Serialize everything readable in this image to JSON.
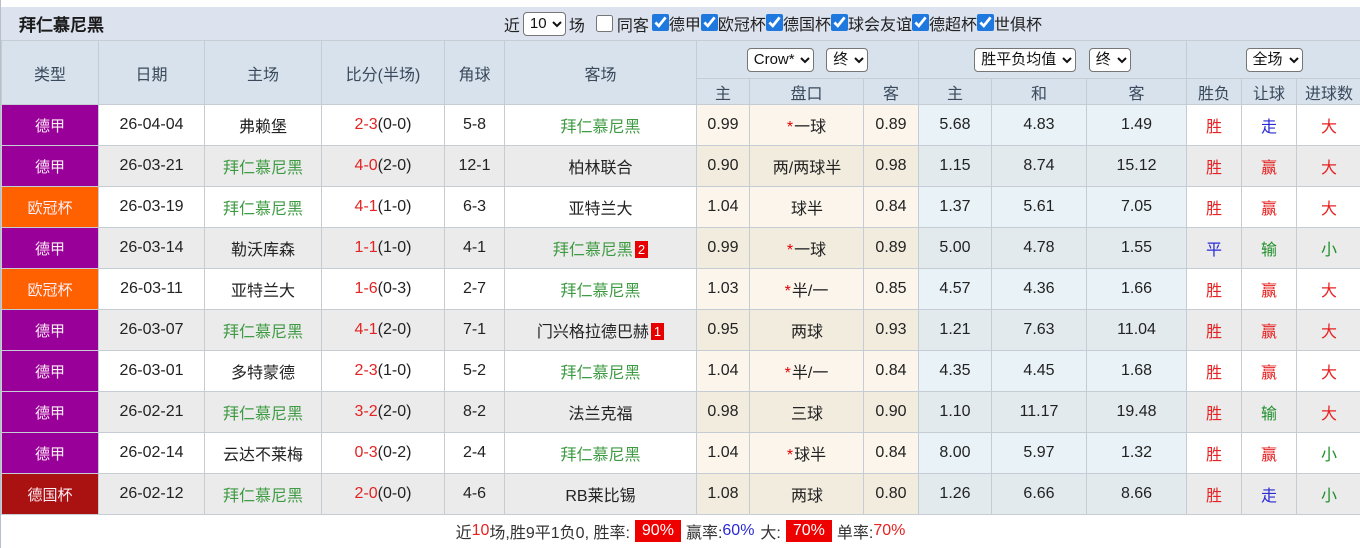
{
  "title": "拜仁慕尼黑",
  "colors": {
    "badge_red": "#e60000",
    "bayern_green": "#3f9b43",
    "rate_highlight": "#ee0000",
    "checkbox_blue": "#1e78dd",
    "league_bundesliga": "#990099",
    "league_ucl": "#ff6000",
    "league_dfb_pokal": "#aa1111"
  },
  "filters": {
    "recent_label": "近",
    "recent_value": "10",
    "matches_label": "场",
    "same_venue": {
      "label": "同客",
      "checked": false
    },
    "leagues": [
      {
        "label": "德甲",
        "checked": true
      },
      {
        "label": "欧冠杯",
        "checked": true
      },
      {
        "label": "德国杯",
        "checked": true
      },
      {
        "label": "球会友谊",
        "checked": true
      },
      {
        "label": "德超杯",
        "checked": true
      },
      {
        "label": "世俱杯",
        "checked": true
      }
    ]
  },
  "table": {
    "headers": {
      "main": [
        "类型",
        "日期",
        "主场",
        "比分(半场)",
        "角球",
        "客场"
      ],
      "sub": [
        "主",
        "盘口",
        "客",
        "主",
        "和",
        "客",
        "胜负",
        "让球",
        "进球数"
      ]
    },
    "selects": {
      "crow_company": "Crow*",
      "crow_time": "终",
      "avg_company": "胜平负均值",
      "avg_time": "终",
      "scope": "全场"
    },
    "rows": [
      {
        "league": "德甲",
        "league_color": "#990099",
        "date": "26-04-04",
        "home": {
          "name": "弗赖堡",
          "is_bayern": false,
          "badge": null
        },
        "score": {
          "main": "2-3",
          "half": "(0-0)"
        },
        "corners": "5-8",
        "away": {
          "name": "拜仁慕尼黑",
          "is_bayern": true,
          "badge": null
        },
        "crow": {
          "home": "0.99",
          "starred": true,
          "handicap": "一球",
          "away": "0.89"
        },
        "odds": {
          "home": "5.68",
          "draw": "4.83",
          "away": "1.49"
        },
        "results": [
          {
            "text": "胜",
            "color": "red"
          },
          {
            "text": "走",
            "color": "blue"
          },
          {
            "text": "大",
            "color": "red"
          }
        ]
      },
      {
        "league": "德甲",
        "league_color": "#990099",
        "date": "26-03-21",
        "home": {
          "name": "拜仁慕尼黑",
          "is_bayern": true,
          "badge": null
        },
        "score": {
          "main": "4-0",
          "half": "(2-0)"
        },
        "corners": "12-1",
        "away": {
          "name": "柏林联合",
          "is_bayern": false,
          "badge": null
        },
        "crow": {
          "home": "0.90",
          "starred": false,
          "handicap": "两/两球半",
          "away": "0.98"
        },
        "odds": {
          "home": "1.15",
          "draw": "8.74",
          "away": "15.12"
        },
        "results": [
          {
            "text": "胜",
            "color": "red"
          },
          {
            "text": "赢",
            "color": "red"
          },
          {
            "text": "大",
            "color": "red"
          }
        ]
      },
      {
        "league": "欧冠杯",
        "league_color": "#ff6000",
        "date": "26-03-19",
        "home": {
          "name": "拜仁慕尼黑",
          "is_bayern": true,
          "badge": null
        },
        "score": {
          "main": "4-1",
          "half": "(1-0)"
        },
        "corners": "6-3",
        "away": {
          "name": "亚特兰大",
          "is_bayern": false,
          "badge": null
        },
        "crow": {
          "home": "1.04",
          "starred": false,
          "handicap": "球半",
          "away": "0.84"
        },
        "odds": {
          "home": "1.37",
          "draw": "5.61",
          "away": "7.05"
        },
        "results": [
          {
            "text": "胜",
            "color": "red"
          },
          {
            "text": "赢",
            "color": "red"
          },
          {
            "text": "大",
            "color": "red"
          }
        ]
      },
      {
        "league": "德甲",
        "league_color": "#990099",
        "date": "26-03-14",
        "home": {
          "name": "勒沃库森",
          "is_bayern": false,
          "badge": null
        },
        "score": {
          "main": "1-1",
          "half": "(1-0)"
        },
        "corners": "4-1",
        "away": {
          "name": "拜仁慕尼黑",
          "is_bayern": true,
          "badge": "2"
        },
        "crow": {
          "home": "0.99",
          "starred": true,
          "handicap": "一球",
          "away": "0.89"
        },
        "odds": {
          "home": "5.00",
          "draw": "4.78",
          "away": "1.55"
        },
        "results": [
          {
            "text": "平",
            "color": "blue"
          },
          {
            "text": "输",
            "color": "green"
          },
          {
            "text": "小",
            "color": "green"
          }
        ]
      },
      {
        "league": "欧冠杯",
        "league_color": "#ff6000",
        "date": "26-03-11",
        "home": {
          "name": "亚特兰大",
          "is_bayern": false,
          "badge": null
        },
        "score": {
          "main": "1-6",
          "half": "(0-3)"
        },
        "corners": "2-7",
        "away": {
          "name": "拜仁慕尼黑",
          "is_bayern": true,
          "badge": null
        },
        "crow": {
          "home": "1.03",
          "starred": true,
          "handicap": "半/一",
          "away": "0.85"
        },
        "odds": {
          "home": "4.57",
          "draw": "4.36",
          "away": "1.66"
        },
        "results": [
          {
            "text": "胜",
            "color": "red"
          },
          {
            "text": "赢",
            "color": "red"
          },
          {
            "text": "大",
            "color": "red"
          }
        ]
      },
      {
        "league": "德甲",
        "league_color": "#990099",
        "date": "26-03-07",
        "home": {
          "name": "拜仁慕尼黑",
          "is_bayern": true,
          "badge": null
        },
        "score": {
          "main": "4-1",
          "half": "(2-0)"
        },
        "corners": "7-1",
        "away": {
          "name": "门兴格拉德巴赫",
          "is_bayern": false,
          "badge": "1"
        },
        "crow": {
          "home": "0.95",
          "starred": false,
          "handicap": "两球",
          "away": "0.93"
        },
        "odds": {
          "home": "1.21",
          "draw": "7.63",
          "away": "11.04"
        },
        "results": [
          {
            "text": "胜",
            "color": "red"
          },
          {
            "text": "赢",
            "color": "red"
          },
          {
            "text": "大",
            "color": "red"
          }
        ]
      },
      {
        "league": "德甲",
        "league_color": "#990099",
        "date": "26-03-01",
        "home": {
          "name": "多特蒙德",
          "is_bayern": false,
          "badge": null
        },
        "score": {
          "main": "2-3",
          "half": "(1-0)"
        },
        "corners": "5-2",
        "away": {
          "name": "拜仁慕尼黑",
          "is_bayern": true,
          "badge": null
        },
        "crow": {
          "home": "1.04",
          "starred": true,
          "handicap": "半/一",
          "away": "0.84"
        },
        "odds": {
          "home": "4.35",
          "draw": "4.45",
          "away": "1.68"
        },
        "results": [
          {
            "text": "胜",
            "color": "red"
          },
          {
            "text": "赢",
            "color": "red"
          },
          {
            "text": "大",
            "color": "red"
          }
        ]
      },
      {
        "league": "德甲",
        "league_color": "#990099",
        "date": "26-02-21",
        "home": {
          "name": "拜仁慕尼黑",
          "is_bayern": true,
          "badge": null
        },
        "score": {
          "main": "3-2",
          "half": "(2-0)"
        },
        "corners": "8-2",
        "away": {
          "name": "法兰克福",
          "is_bayern": false,
          "badge": null
        },
        "crow": {
          "home": "0.98",
          "starred": false,
          "handicap": "三球",
          "away": "0.90"
        },
        "odds": {
          "home": "1.10",
          "draw": "11.17",
          "away": "19.48"
        },
        "results": [
          {
            "text": "胜",
            "color": "red"
          },
          {
            "text": "输",
            "color": "green"
          },
          {
            "text": "大",
            "color": "red"
          }
        ]
      },
      {
        "league": "德甲",
        "league_color": "#990099",
        "date": "26-02-14",
        "home": {
          "name": "云达不莱梅",
          "is_bayern": false,
          "badge": null
        },
        "score": {
          "main": "0-3",
          "half": "(0-2)"
        },
        "corners": "2-4",
        "away": {
          "name": "拜仁慕尼黑",
          "is_bayern": true,
          "badge": null
        },
        "crow": {
          "home": "1.04",
          "starred": true,
          "handicap": "球半",
          "away": "0.84"
        },
        "odds": {
          "home": "8.00",
          "draw": "5.97",
          "away": "1.32"
        },
        "results": [
          {
            "text": "胜",
            "color": "red"
          },
          {
            "text": "赢",
            "color": "red"
          },
          {
            "text": "小",
            "color": "green"
          }
        ]
      },
      {
        "league": "德国杯",
        "league_color": "#aa1111",
        "date": "26-02-12",
        "home": {
          "name": "拜仁慕尼黑",
          "is_bayern": true,
          "badge": null
        },
        "score": {
          "main": "2-0",
          "half": "(0-0)"
        },
        "corners": "4-6",
        "away": {
          "name": "RB莱比锡",
          "is_bayern": false,
          "badge": null
        },
        "crow": {
          "home": "1.08",
          "starred": false,
          "handicap": "两球",
          "away": "0.80"
        },
        "odds": {
          "home": "1.26",
          "draw": "6.66",
          "away": "8.66"
        },
        "results": [
          {
            "text": "胜",
            "color": "red"
          },
          {
            "text": "走",
            "color": "blue"
          },
          {
            "text": "小",
            "color": "green"
          }
        ]
      }
    ]
  },
  "footer": {
    "prefix": "近",
    "count": "10",
    "summary": "场,胜9平1负0, 胜率:",
    "win_rate": "90%",
    "profit_label": "赢率:",
    "profit_value": "60%",
    "big_label": "大:",
    "big_value": "70%",
    "single_label": "单率:",
    "single_value": "70%"
  }
}
